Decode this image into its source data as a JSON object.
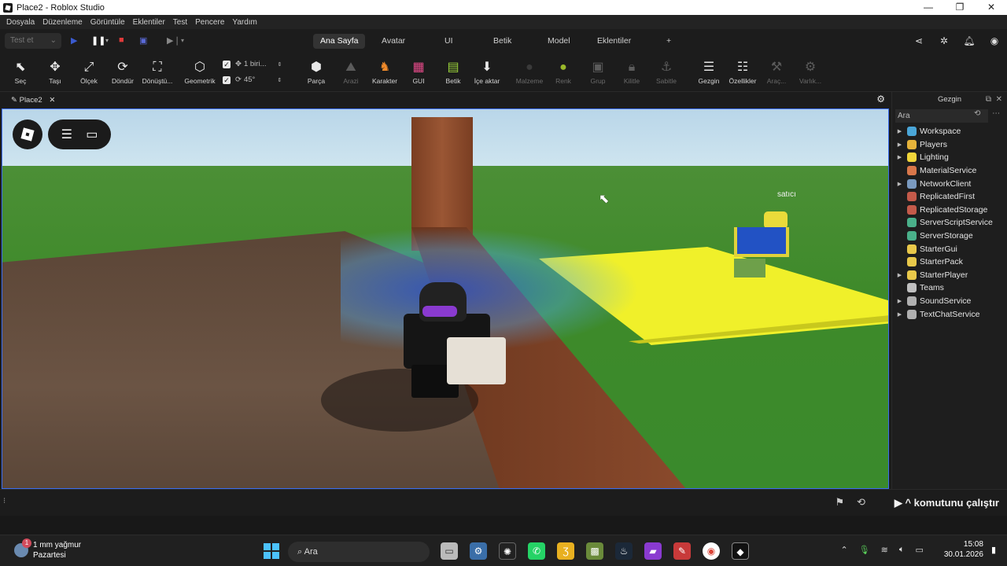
{
  "window": {
    "title": "Place2 - Roblox Studio",
    "controls": [
      "—",
      "❐",
      "✕"
    ]
  },
  "menu": [
    "Dosyala",
    "Düzenleme",
    "Görüntüle",
    "Eklentiler",
    "Test",
    "Pencere",
    "Yardım"
  ],
  "ribbon": {
    "test_select": "Test et",
    "tabs": [
      {
        "label": "Ana Sayfa",
        "active": true
      },
      {
        "label": "Avatar"
      },
      {
        "label": "UI"
      },
      {
        "label": "Betik"
      },
      {
        "label": "Model"
      },
      {
        "label": "Eklentiler"
      },
      {
        "label": "+"
      }
    ]
  },
  "toolbar": {
    "tools": [
      {
        "label": "Seç",
        "icon": "cursor-arrow-icon",
        "glyph": "⬉"
      },
      {
        "label": "Taşı",
        "icon": "move-arrows-icon",
        "glyph": "✥"
      },
      {
        "label": "Ölçek",
        "icon": "scale-icon",
        "glyph": "⤢"
      },
      {
        "label": "Döndür",
        "icon": "rotate-icon",
        "glyph": "⟳"
      },
      {
        "label": "Dönüştü...",
        "icon": "transform-icon",
        "glyph": "⛶"
      },
      {
        "label": "Geometrik",
        "icon": "geometry-icon",
        "glyph": "⬡"
      },
      {
        "label": "Parça",
        "icon": "part-cube-icon",
        "glyph": "⬢"
      },
      {
        "label": "Arazi",
        "icon": "terrain-icon",
        "glyph": "⛰",
        "dim": true
      },
      {
        "label": "Karakter",
        "icon": "character-icon",
        "glyph": "♞"
      },
      {
        "label": "GUI",
        "icon": "gui-icon",
        "glyph": "▦"
      },
      {
        "label": "Betik",
        "icon": "script-icon",
        "glyph": "▤"
      },
      {
        "label": "İçe aktar",
        "icon": "import-icon",
        "glyph": "⬇"
      },
      {
        "label": "Malzeme",
        "icon": "material-icon",
        "glyph": "●",
        "dim": true
      },
      {
        "label": "Renk",
        "icon": "color-icon",
        "glyph": "●",
        "dim": true
      },
      {
        "label": "Grup",
        "icon": "group-icon",
        "glyph": "▣",
        "dim": true
      },
      {
        "label": "Kilitle",
        "icon": "lock-icon",
        "glyph": "🔒︎",
        "dim": true
      },
      {
        "label": "Sabitle",
        "icon": "anchor-icon",
        "glyph": "⚓︎",
        "dim": true
      },
      {
        "label": "Gezgin",
        "icon": "explorer-icon",
        "glyph": "☰"
      },
      {
        "label": "Özellikler",
        "icon": "properties-icon",
        "glyph": "☷"
      },
      {
        "label": "Araç...",
        "icon": "tools-icon",
        "glyph": "⚒",
        "dim": true
      },
      {
        "label": "Varlık...",
        "icon": "assets-icon",
        "glyph": "⚙",
        "dim": true
      }
    ],
    "snap_move": "1 biri...",
    "snap_rotate": "45°"
  },
  "document_tab": {
    "label": "Place2"
  },
  "viewport": {
    "npc_label": "satıcı"
  },
  "explorer": {
    "title": "Gezgin",
    "search_placeholder": "Ara",
    "items": [
      {
        "label": "Workspace",
        "expandable": true,
        "color": "#4aa6d8"
      },
      {
        "label": "Players",
        "expandable": true,
        "color": "#e6b33a"
      },
      {
        "label": "Lighting",
        "expandable": true,
        "color": "#f0d53a"
      },
      {
        "label": "MaterialService",
        "expandable": false,
        "color": "#d9774a"
      },
      {
        "label": "NetworkClient",
        "expandable": true,
        "color": "#7a9ac0"
      },
      {
        "label": "ReplicatedFirst",
        "expandable": false,
        "color": "#c45a4a"
      },
      {
        "label": "ReplicatedStorage",
        "expandable": false,
        "color": "#c45a4a"
      },
      {
        "label": "ServerScriptService",
        "expandable": false,
        "color": "#4ab08a"
      },
      {
        "label": "ServerStorage",
        "expandable": false,
        "color": "#4ab08a"
      },
      {
        "label": "StarterGui",
        "expandable": false,
        "color": "#e8c84a"
      },
      {
        "label": "StarterPack",
        "expandable": false,
        "color": "#e8c84a"
      },
      {
        "label": "StarterPlayer",
        "expandable": true,
        "color": "#e8c84a"
      },
      {
        "label": "Teams",
        "expandable": false,
        "color": "#c0c0c0"
      },
      {
        "label": "SoundService",
        "expandable": true,
        "color": "#b0b0b0"
      },
      {
        "label": "TextChatService",
        "expandable": true,
        "color": "#b0b0b0"
      }
    ]
  },
  "command_bar": {
    "run_label": "^ komutunu çalıştır"
  },
  "taskbar": {
    "weather_line1": "1 mm yağmur",
    "weather_line2": "Pazartesi",
    "weather_badge": "1",
    "search_label": "Ara",
    "time": "15:08",
    "date": "30.01.2026"
  }
}
